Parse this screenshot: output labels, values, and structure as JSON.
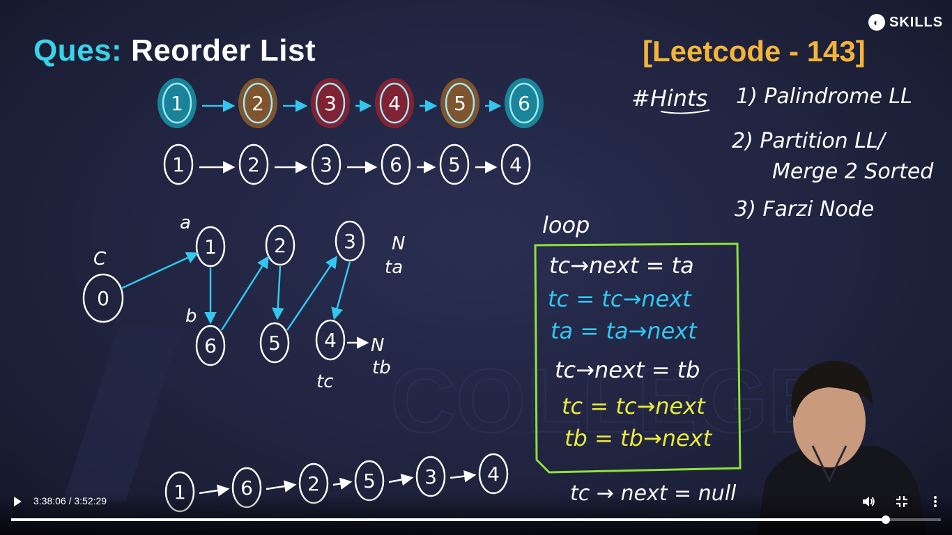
{
  "slide": {
    "title_prefix": "Ques:",
    "title_main": "Reorder List",
    "leetcode": "[Leetcode - 143]",
    "brand_text": "SKILLS"
  },
  "colors": {
    "accent_cyan": "#38d3e6",
    "accent_orange": "#f3b43a",
    "box_green": "#8ee23a",
    "text_yellow": "#e9ea3c",
    "arrow_blue": "#32c7f0"
  },
  "row1": {
    "nodes": [
      "1",
      "2",
      "3",
      "4",
      "5",
      "6"
    ],
    "fills": [
      "#1a8ea3",
      "#8a5a2c",
      "#8a2233",
      "#8a2233",
      "#8a5a2c",
      "#1a8ea3"
    ]
  },
  "row2": {
    "nodes": [
      "1",
      "2",
      "3",
      "6",
      "5",
      "4"
    ]
  },
  "diagram": {
    "node_c": "0",
    "label_c": "C",
    "top_nodes": [
      "1",
      "2",
      "3"
    ],
    "bottom_nodes": [
      "6",
      "5",
      "4"
    ],
    "label_a": "a",
    "label_b": "b",
    "label_N_top": "N",
    "label_ta": "ta",
    "label_N_right": "N",
    "label_tb": "tb",
    "label_tc": "tc"
  },
  "row3": {
    "nodes": [
      "1",
      "6",
      "2",
      "5",
      "3",
      "4"
    ]
  },
  "hints": {
    "heading": "#Hints",
    "items": [
      "1) Palindrome LL",
      "2) Partition LL/",
      "Merge 2 Sorted",
      "3) Farzi Node"
    ]
  },
  "loop": {
    "label": "loop",
    "lines": [
      {
        "text": "tc→next = ta",
        "color": "#ffffff"
      },
      {
        "text": "tc = tc→next",
        "color": "#32c7f0"
      },
      {
        "text": "ta = ta→next",
        "color": "#32c7f0"
      },
      {
        "text": "tc→next = tb",
        "color": "#ffffff"
      },
      {
        "text": "tc = tc→next",
        "color": "#e9ea3c"
      },
      {
        "text": "tb = tb→next",
        "color": "#e9ea3c"
      }
    ],
    "after": "tc → next = null"
  },
  "player": {
    "time": "3:38:06 / 3:52:29",
    "progress": 0.941,
    "play_icon": "play-icon",
    "volume_icon": "volume-icon",
    "fullscreen_icon": "exit-fullscreen-icon",
    "menu_icon": "more-vert-icon"
  }
}
